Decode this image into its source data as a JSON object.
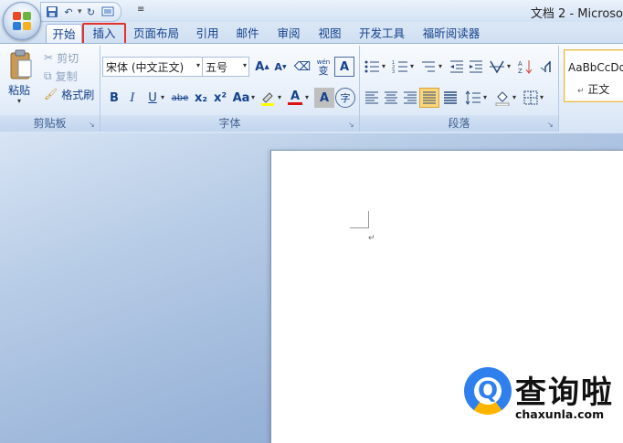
{
  "window": {
    "title": "文档 2 - Microso"
  },
  "quick_access": {
    "items": [
      "save-icon",
      "undo-icon",
      "redo-icon",
      "print-preview-icon"
    ]
  },
  "tabs": [
    {
      "label": "开始",
      "active": true,
      "highlighted": false
    },
    {
      "label": "插入",
      "active": false,
      "highlighted": true
    },
    {
      "label": "页面布局",
      "active": false,
      "highlighted": false
    },
    {
      "label": "引用",
      "active": false,
      "highlighted": false
    },
    {
      "label": "邮件",
      "active": false,
      "highlighted": false
    },
    {
      "label": "审阅",
      "active": false,
      "highlighted": false
    },
    {
      "label": "视图",
      "active": false,
      "highlighted": false
    },
    {
      "label": "开发工具",
      "active": false,
      "highlighted": false
    },
    {
      "label": "福昕阅读器",
      "active": false,
      "highlighted": false
    }
  ],
  "clipboard": {
    "paste_label": "粘贴",
    "cut_label": "剪切",
    "copy_label": "复制",
    "format_painter_label": "格式刷",
    "group_label": "剪贴板"
  },
  "font": {
    "font_name": "宋体 (中文正文)",
    "font_size": "五号",
    "group_label": "字体",
    "pinyin_glyph": "wén",
    "pinyin_char": "变",
    "border_char": "A",
    "bold": "B",
    "italic": "I",
    "underline": "U",
    "strike": "abe",
    "subscript": "x₂",
    "superscript": "x²",
    "change_case": "Aa",
    "font_color": "A",
    "shading": "A",
    "enclose": "字",
    "grow": "A",
    "shrink": "A"
  },
  "paragraph": {
    "group_label": "段落"
  },
  "styles": {
    "preview": "AaBbCcDd",
    "name": "正文"
  },
  "watermark": {
    "brand": "查询啦",
    "url": "chaxunla.com",
    "logo_letter": "Q"
  },
  "colors": {
    "highlight_box": "#e3312d",
    "ribbon_text": "#15428b"
  }
}
